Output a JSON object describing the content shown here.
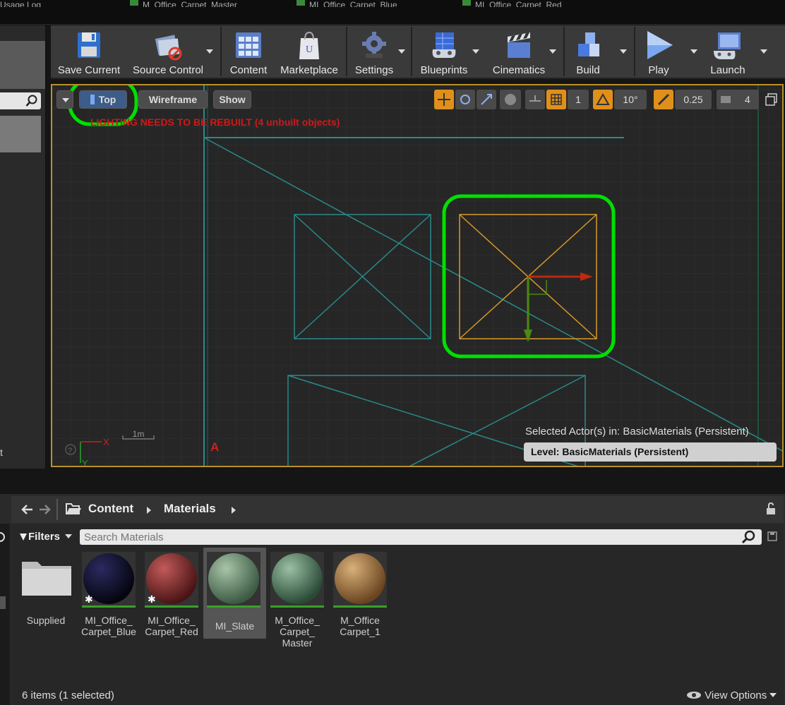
{
  "tabs": [
    {
      "label": "Usage Log"
    },
    {
      "label": "M_Office_Carpet_Master"
    },
    {
      "label": "MI_Office_Carpet_Blue"
    },
    {
      "label": "MI_Office_Carpet_Red"
    }
  ],
  "toolbar": {
    "items": [
      {
        "label": "Save Current",
        "icon": "floppy-disk-icon"
      },
      {
        "label": "Source Control",
        "icon": "source-control-icon"
      },
      {
        "label": "Content",
        "icon": "content-grid-icon"
      },
      {
        "label": "Marketplace",
        "icon": "marketplace-bag-icon"
      },
      {
        "label": "Settings",
        "icon": "gear-icon"
      },
      {
        "label": "Blueprints",
        "icon": "blueprint-gamepad-icon"
      },
      {
        "label": "Cinematics",
        "icon": "clapperboard-icon"
      },
      {
        "label": "Build",
        "icon": "build-blocks-icon"
      },
      {
        "label": "Play",
        "icon": "play-icon"
      },
      {
        "label": "Launch",
        "icon": "launch-monitor-icon"
      }
    ]
  },
  "viewport": {
    "view_mode": "Top",
    "render_mode": "Wireframe",
    "show_label": "Show",
    "warning": "LIGHTING NEEDS TO BE REBUILT (4 unbuilt objects)",
    "camera_speed": "4",
    "rotation_snap": "10°",
    "scale_snap": "0.25",
    "grid_snap": "1",
    "scale_label": "1m",
    "axis_x": "X",
    "axis_y": "Y",
    "marker": "A",
    "selected_actor_text": "Selected Actor(s) in:  BasicMaterials (Persistent)",
    "level_text": "Level:  BasicMaterials (Persistent)",
    "accent": "#b8902a",
    "highlight": "#00e000"
  },
  "content_browser": {
    "breadcrumb": [
      "Content",
      "Materials"
    ],
    "filters_label": "Filters",
    "search_placeholder": "Search Materials",
    "assets": [
      {
        "name": "Supplied",
        "kind": "folder"
      },
      {
        "name": "MI_Office_\nCarpet_Blue",
        "kind": "material-instance"
      },
      {
        "name": "MI_Office_\nCarpet_Red",
        "kind": "material-instance"
      },
      {
        "name": "MI_Slate",
        "kind": "material-instance",
        "selected": true
      },
      {
        "name": "M_Office_\nCarpet_\nMaster",
        "kind": "material"
      },
      {
        "name": "M_Office\nCarpet_1",
        "kind": "material"
      }
    ],
    "status": "6 items (1 selected)",
    "view_options": "View Options"
  },
  "left_panel": {
    "trailing_text": "t"
  }
}
